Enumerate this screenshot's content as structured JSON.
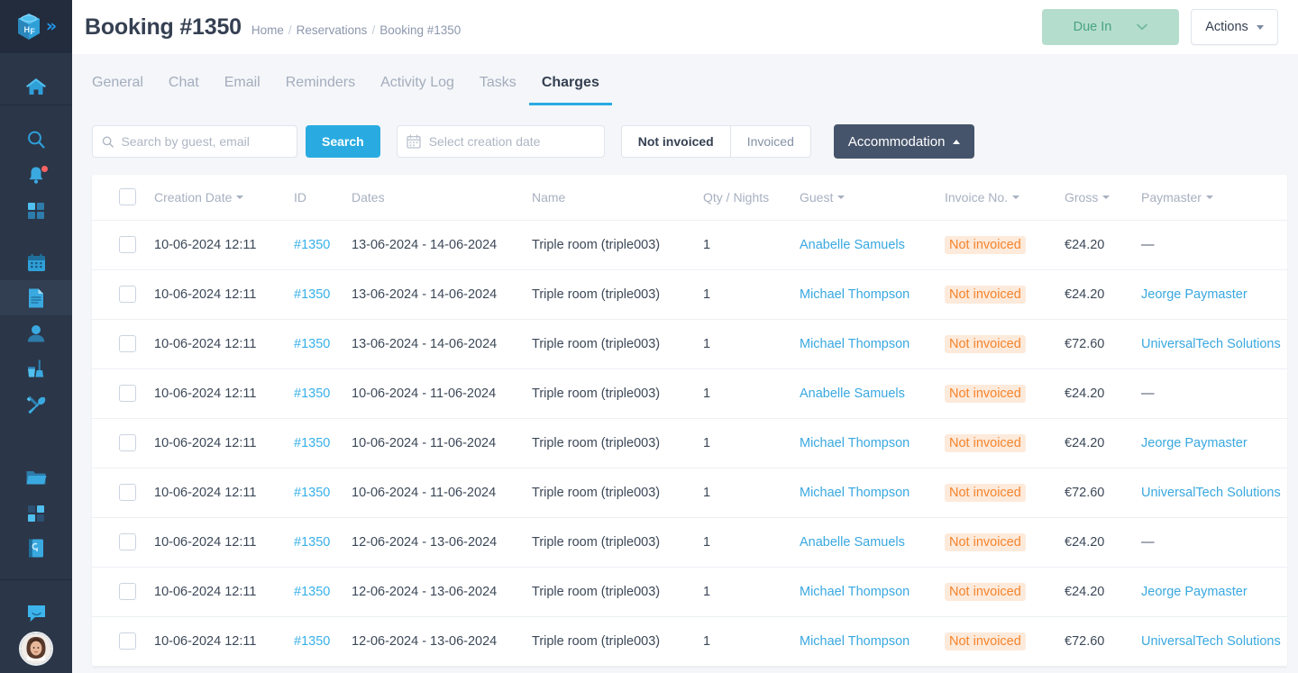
{
  "sidebar": {
    "logo_label": "HF",
    "expand_icon": "double-chevron-right-icon",
    "items": [
      {
        "id": "home",
        "icon": "home-icon",
        "active": false,
        "badge": false
      },
      {
        "id": "search",
        "icon": "search-icon",
        "active": false,
        "badge": false
      },
      {
        "id": "notifications",
        "icon": "bell-icon",
        "active": false,
        "badge": true
      },
      {
        "id": "apps",
        "icon": "grid-apps-icon",
        "active": false,
        "badge": false
      },
      {
        "id": "calendar",
        "icon": "calendar-icon",
        "active": false,
        "badge": false
      },
      {
        "id": "reservations",
        "icon": "document-icon",
        "active": true,
        "badge": false
      },
      {
        "id": "guests",
        "icon": "user-icon",
        "active": false,
        "badge": false
      },
      {
        "id": "housekeeping",
        "icon": "cleaning-icon",
        "active": false,
        "badge": false
      },
      {
        "id": "maintenance",
        "icon": "tools-icon",
        "active": false,
        "badge": false
      },
      {
        "id": "files",
        "icon": "folder-icon",
        "active": false,
        "badge": false
      },
      {
        "id": "widgets",
        "icon": "grid-widgets-icon",
        "active": false,
        "badge": false
      },
      {
        "id": "knowledge",
        "icon": "book-icon",
        "active": false,
        "badge": false
      },
      {
        "id": "chat",
        "icon": "chat-bubble-icon",
        "active": false,
        "badge": false
      }
    ],
    "avatar": "user-avatar"
  },
  "header": {
    "title": "Booking #1350",
    "breadcrumb": [
      {
        "label": "Home",
        "link": true
      },
      {
        "label": "Reservations",
        "link": true
      },
      {
        "label": "Booking #1350",
        "link": false
      }
    ],
    "breadcrumb_sep": "/",
    "status_button": {
      "label": "Due In",
      "icon": "chevron-down-icon",
      "bg": "#b5ddcd",
      "fg": "#48a383"
    },
    "actions_button": {
      "label": "Actions",
      "icon": "caret-down-icon"
    }
  },
  "tabs": [
    {
      "label": "General",
      "active": false
    },
    {
      "label": "Chat",
      "active": false
    },
    {
      "label": "Email",
      "active": false
    },
    {
      "label": "Reminders",
      "active": false
    },
    {
      "label": "Activity Log",
      "active": false
    },
    {
      "label": "Tasks",
      "active": false
    },
    {
      "label": "Charges",
      "active": true
    }
  ],
  "filters": {
    "search_placeholder": "Search by guest, email",
    "search_value": "",
    "search_icon": "search-icon",
    "search_button": "Search",
    "date_placeholder": "Select creation date",
    "date_icon": "calendar-icon",
    "segments": [
      {
        "label": "Not invoiced",
        "selected": true
      },
      {
        "label": "Invoiced",
        "selected": false
      }
    ],
    "accommodation_button": {
      "label": "Accommodation",
      "icon": "chevron-up-icon"
    }
  },
  "table": {
    "select_all_checkbox": false,
    "columns": [
      {
        "key": "checkbox",
        "label": "",
        "sortable": false
      },
      {
        "key": "creation_date",
        "label": "Creation Date",
        "sortable": true
      },
      {
        "key": "id",
        "label": "ID",
        "sortable": false
      },
      {
        "key": "dates",
        "label": "Dates",
        "sortable": false
      },
      {
        "key": "name",
        "label": "Name",
        "sortable": false
      },
      {
        "key": "qty",
        "label": "Qty / Nights",
        "sortable": false
      },
      {
        "key": "guest",
        "label": "Guest",
        "sortable": true
      },
      {
        "key": "invoice_no",
        "label": "Invoice No.",
        "sortable": true
      },
      {
        "key": "gross",
        "label": "Gross",
        "sortable": true
      },
      {
        "key": "paymaster",
        "label": "Paymaster",
        "sortable": true
      }
    ],
    "rows": [
      {
        "creation_date": "10-06-2024 12:11",
        "id": "#1350",
        "dates": "13-06-2024 - 14-06-2024",
        "name": "Triple room (triple003)",
        "qty": "1",
        "guest": "Anabelle Samuels",
        "invoice_no": "Not invoiced",
        "gross": "€24.20",
        "paymaster": "—"
      },
      {
        "creation_date": "10-06-2024 12:11",
        "id": "#1350",
        "dates": "13-06-2024 - 14-06-2024",
        "name": "Triple room (triple003)",
        "qty": "1",
        "guest": "Michael Thompson",
        "invoice_no": "Not invoiced",
        "gross": "€24.20",
        "paymaster": "Jeorge Paymaster"
      },
      {
        "creation_date": "10-06-2024 12:11",
        "id": "#1350",
        "dates": "13-06-2024 - 14-06-2024",
        "name": "Triple room (triple003)",
        "qty": "1",
        "guest": "Michael Thompson",
        "invoice_no": "Not invoiced",
        "gross": "€72.60",
        "paymaster": "UniversalTech Solutions"
      },
      {
        "creation_date": "10-06-2024 12:11",
        "id": "#1350",
        "dates": "10-06-2024 - 11-06-2024",
        "name": "Triple room (triple003)",
        "qty": "1",
        "guest": "Anabelle Samuels",
        "invoice_no": "Not invoiced",
        "gross": "€24.20",
        "paymaster": "—"
      },
      {
        "creation_date": "10-06-2024 12:11",
        "id": "#1350",
        "dates": "10-06-2024 - 11-06-2024",
        "name": "Triple room (triple003)",
        "qty": "1",
        "guest": "Michael Thompson",
        "invoice_no": "Not invoiced",
        "gross": "€24.20",
        "paymaster": "Jeorge Paymaster"
      },
      {
        "creation_date": "10-06-2024 12:11",
        "id": "#1350",
        "dates": "10-06-2024 - 11-06-2024",
        "name": "Triple room (triple003)",
        "qty": "1",
        "guest": "Michael Thompson",
        "invoice_no": "Not invoiced",
        "gross": "€72.60",
        "paymaster": "UniversalTech Solutions"
      },
      {
        "creation_date": "10-06-2024 12:11",
        "id": "#1350",
        "dates": "12-06-2024 - 13-06-2024",
        "name": "Triple room (triple003)",
        "qty": "1",
        "guest": "Anabelle Samuels",
        "invoice_no": "Not invoiced",
        "gross": "€24.20",
        "paymaster": "—"
      },
      {
        "creation_date": "10-06-2024 12:11",
        "id": "#1350",
        "dates": "12-06-2024 - 13-06-2024",
        "name": "Triple room (triple003)",
        "qty": "1",
        "guest": "Michael Thompson",
        "invoice_no": "Not invoiced",
        "gross": "€24.20",
        "paymaster": "Jeorge Paymaster"
      },
      {
        "creation_date": "10-06-2024 12:11",
        "id": "#1350",
        "dates": "12-06-2024 - 13-06-2024",
        "name": "Triple room (triple003)",
        "qty": "1",
        "guest": "Michael Thompson",
        "invoice_no": "Not invoiced",
        "gross": "€72.60",
        "paymaster": "UniversalTech Solutions"
      }
    ]
  },
  "colors": {
    "accent_blue": "#29abe2",
    "link_blue": "#37b0e9",
    "sidebar_bg": "#2b3648",
    "warning_orange": "#f5842c",
    "warning_bg": "#fdeadb",
    "dark_slate": "#46546b"
  }
}
